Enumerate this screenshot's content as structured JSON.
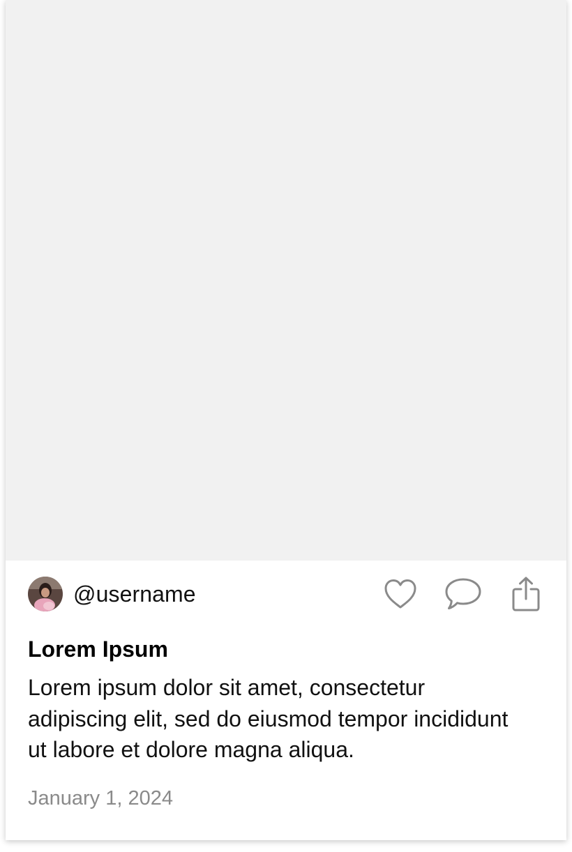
{
  "post": {
    "author": {
      "username": "@username",
      "avatar_icon": "user-photo-avatar"
    },
    "actions": [
      {
        "icon": "heart-icon"
      },
      {
        "icon": "comment-icon"
      },
      {
        "icon": "share-icon"
      }
    ],
    "title": "Lorem Ipsum",
    "body": "Lorem ipsum dolor sit amet, consectetur adipiscing elit, sed do eiusmod tempor incididunt ut labore et dolore magna aliqua.",
    "date": "January 1, 2024"
  },
  "colors": {
    "media_placeholder": "#f1f1f1",
    "icon_stroke": "#8a8a8a",
    "date_text": "#8a8a8a",
    "text": "#111111"
  }
}
